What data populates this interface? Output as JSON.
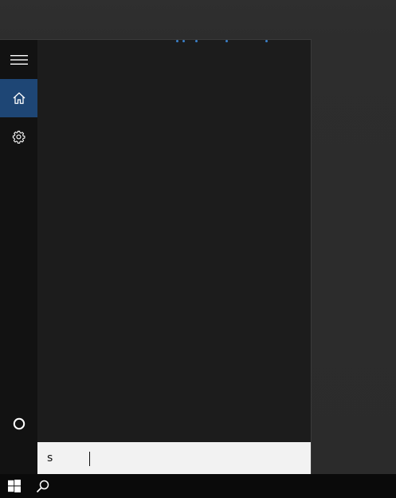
{
  "search": {
    "query": "s",
    "caret_visible": true
  },
  "rail": {
    "items": [
      {
        "id": "menu",
        "icon": "hamburger-icon"
      },
      {
        "id": "home",
        "icon": "home-icon",
        "selected": true
      },
      {
        "id": "settings",
        "icon": "gear-icon"
      },
      {
        "id": "cortana",
        "icon": "cortana-circle-icon"
      }
    ]
  },
  "taskbar": {
    "items": [
      {
        "id": "start",
        "icon": "windows-logo-icon"
      },
      {
        "id": "search",
        "icon": "search-icon"
      }
    ]
  },
  "colors": {
    "accent": "#1e4675",
    "panel": "#1c1c1c",
    "rail": "#121212",
    "taskbar": "#0a0a0a",
    "searchbox": "#f2f2f2",
    "loading_dots": "#3c80c8"
  }
}
